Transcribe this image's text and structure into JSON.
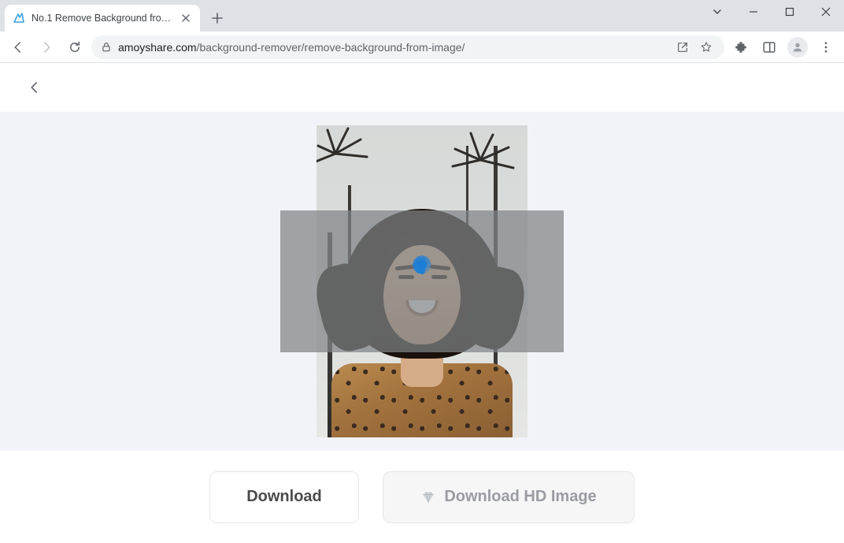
{
  "browser": {
    "tab_title": "No.1 Remove Background from I",
    "url_host": "amoyshare.com",
    "url_path": "/background-remover/remove-background-from-image/"
  },
  "page": {
    "state": "loading"
  },
  "actions": {
    "download_label": "Download",
    "download_hd_label": "Download HD Image"
  },
  "icons": {
    "favicon": "amoyshare-logo-icon",
    "diamond": "diamond-icon"
  },
  "colors": {
    "spinner": "#1f7fd6",
    "page_bg": "#f2f3f8"
  }
}
